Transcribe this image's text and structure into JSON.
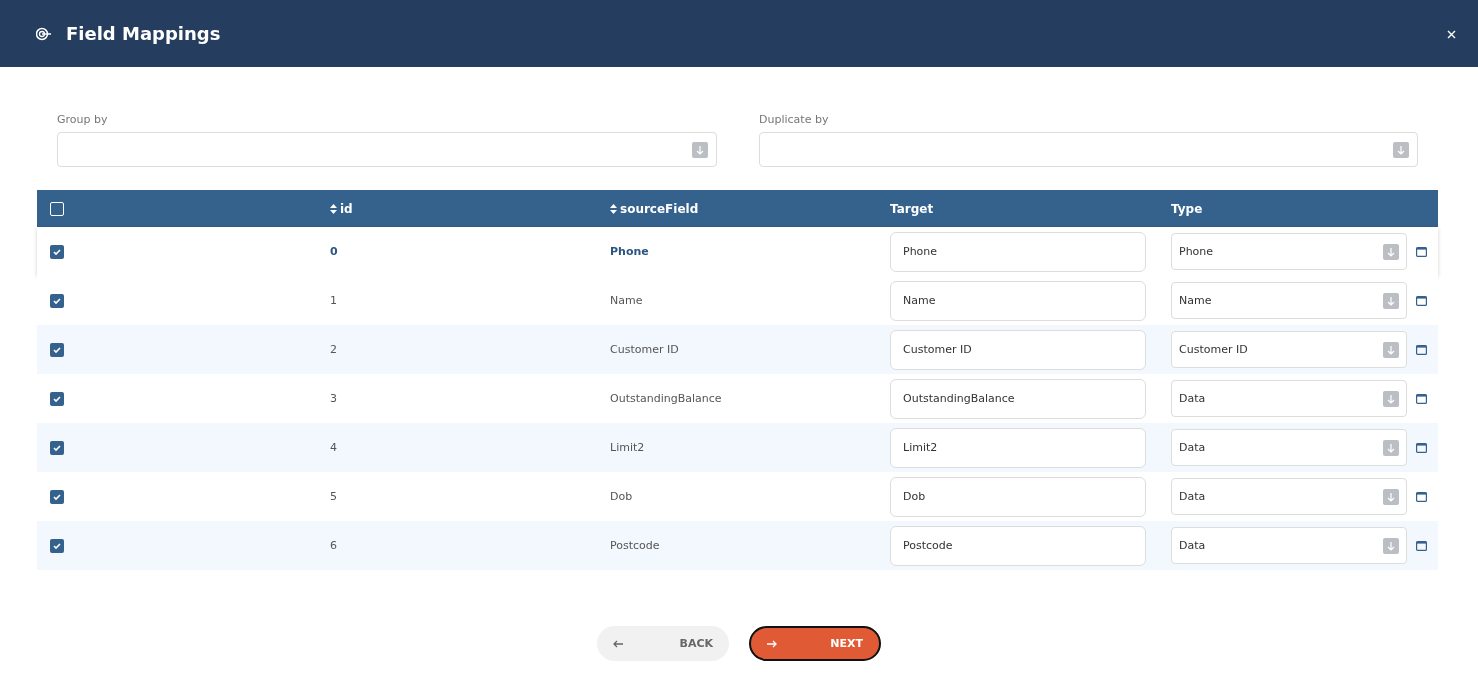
{
  "window": {
    "title": "Field Mappings"
  },
  "filters": [
    {
      "label": "Group by"
    },
    {
      "label": "Duplicate by"
    }
  ],
  "table": {
    "all_checked": false,
    "columns": [
      {
        "label": "id",
        "sortable": true
      },
      {
        "label": "sourceField",
        "sortable": true
      },
      {
        "label": "Target",
        "sortable": false
      },
      {
        "label": "Type",
        "sortable": false
      }
    ],
    "rows": [
      {
        "checked": true,
        "selected": true,
        "id": "0",
        "source": "Phone",
        "target": "Phone",
        "type": "Phone"
      },
      {
        "checked": true,
        "selected": false,
        "id": "1",
        "source": "Name",
        "target": "Name",
        "type": "Name"
      },
      {
        "checked": true,
        "selected": false,
        "id": "2",
        "source": "Customer ID",
        "target": "Customer ID",
        "type": "Customer ID"
      },
      {
        "checked": true,
        "selected": false,
        "id": "3",
        "source": "OutstandingBalance",
        "target": "OutstandingBalance",
        "type": "Data"
      },
      {
        "checked": true,
        "selected": false,
        "id": "4",
        "source": "Limit2",
        "target": "Limit2",
        "type": "Data"
      },
      {
        "checked": true,
        "selected": false,
        "id": "5",
        "source": "Dob",
        "target": "Dob",
        "type": "Data"
      },
      {
        "checked": true,
        "selected": false,
        "id": "6",
        "source": "Postcode",
        "target": "Postcode",
        "type": "Data"
      }
    ]
  },
  "buttons": [
    {
      "label": "BACK",
      "kind": "back"
    },
    {
      "label": "NEXT",
      "kind": "next"
    }
  ]
}
